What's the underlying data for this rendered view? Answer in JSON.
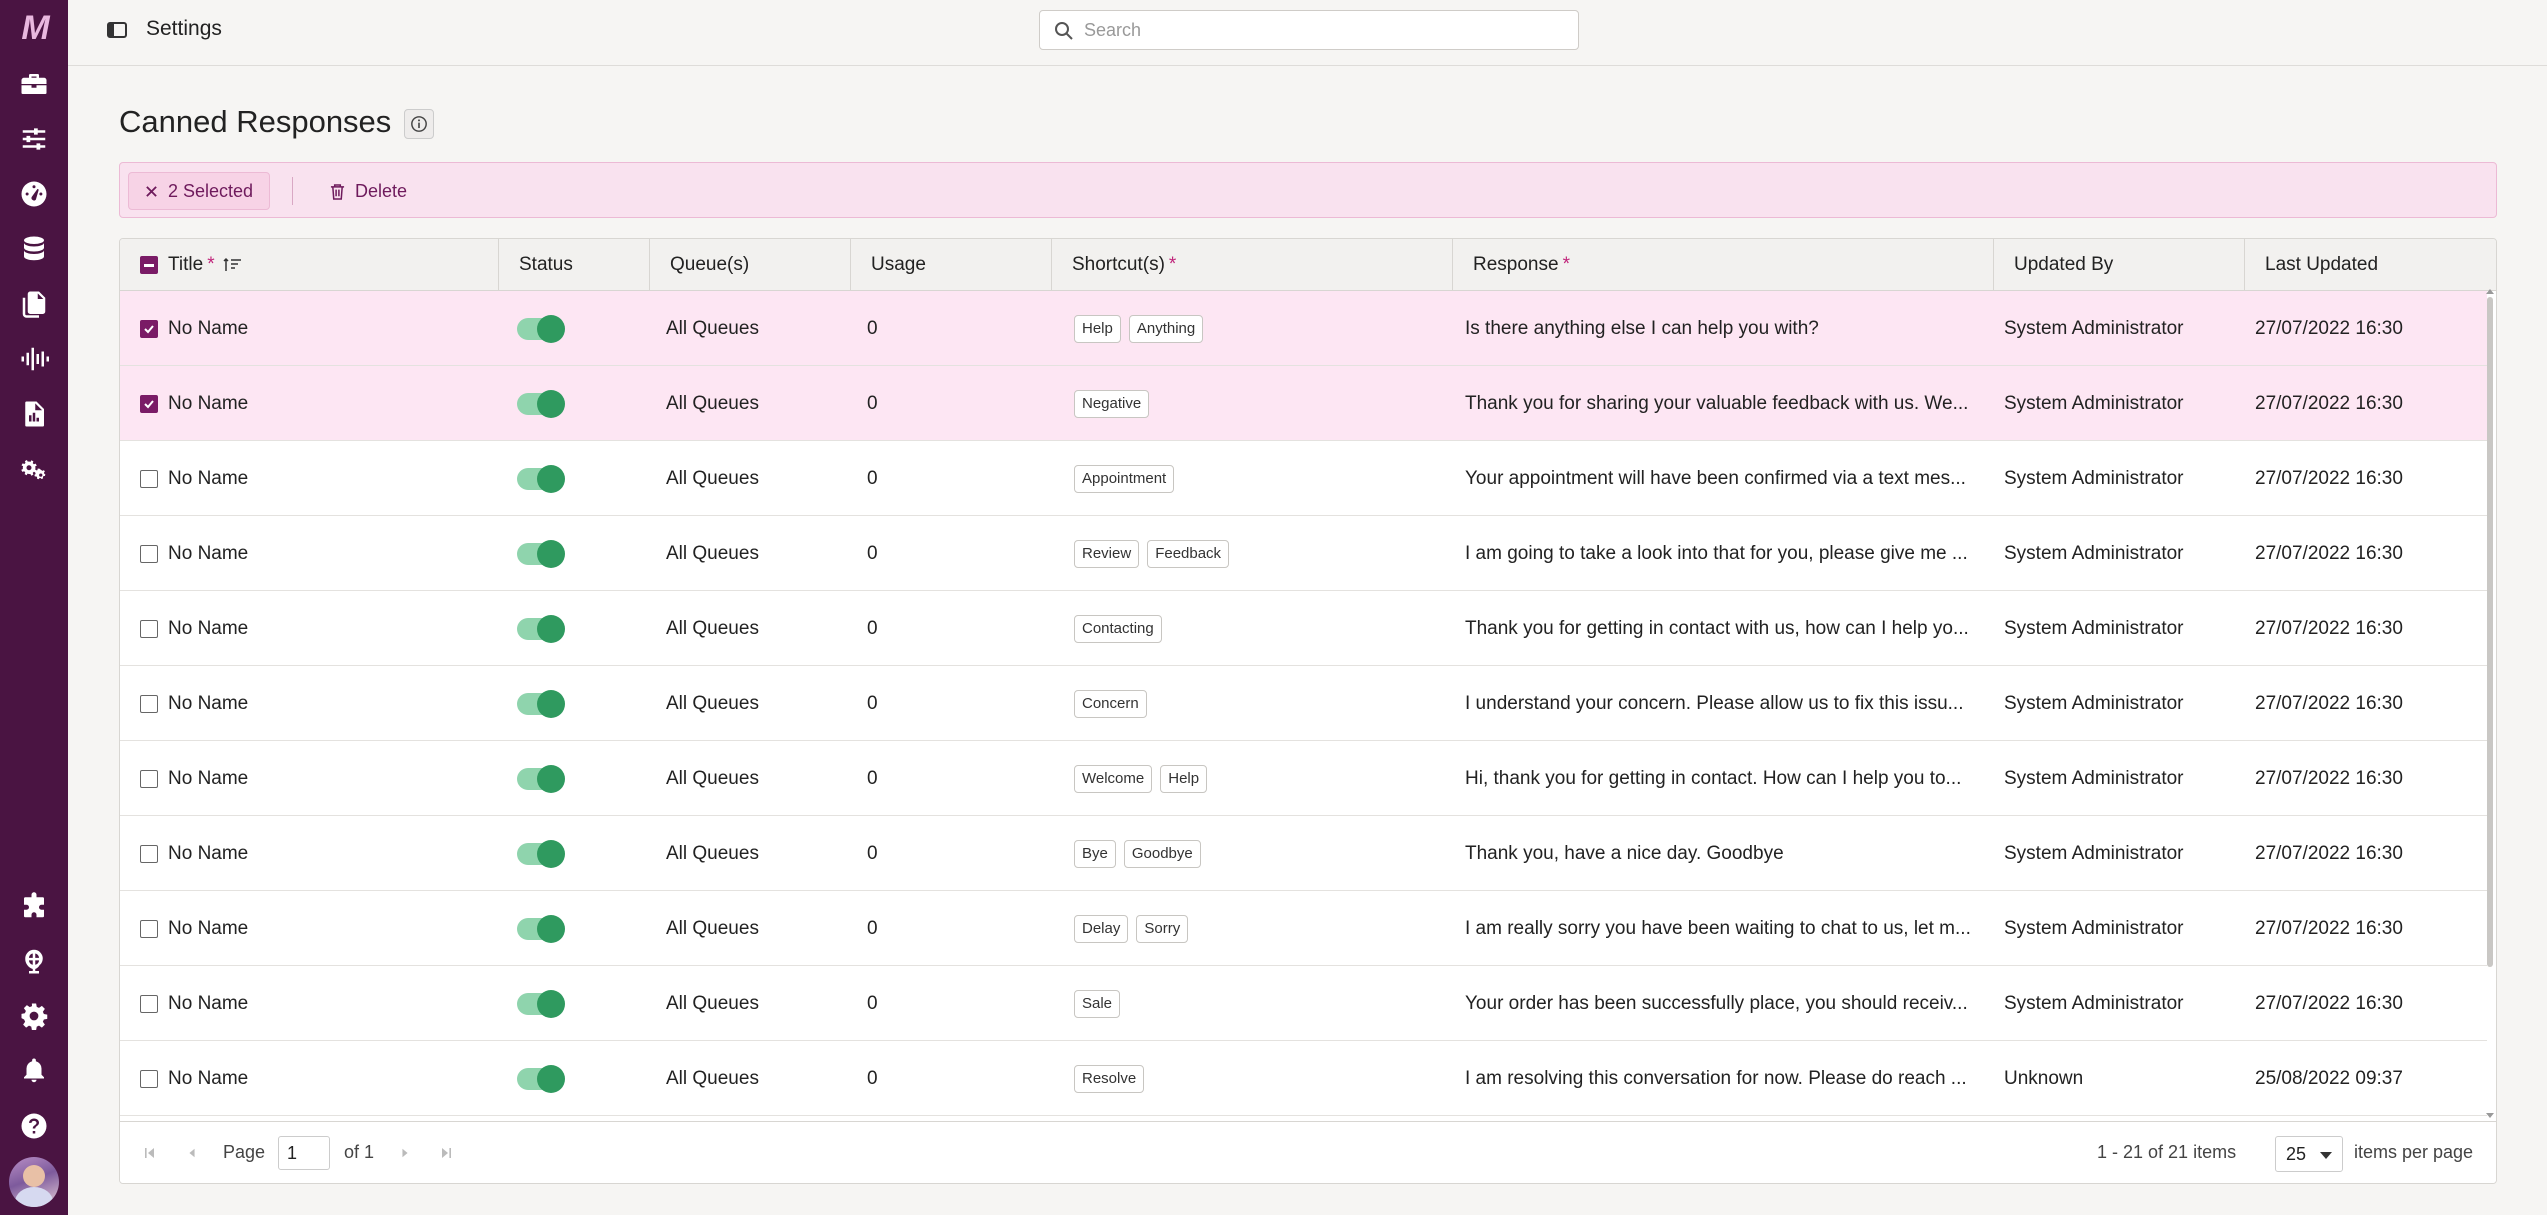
{
  "app": {
    "logo_text": "M"
  },
  "sidebar": {
    "top_icons": [
      "toolbox-icon",
      "sliders-icon",
      "dashboard-gauge-icon",
      "database-icon",
      "documents-icon",
      "audio-waveform-icon",
      "report-file-icon",
      "cogs-icon"
    ],
    "bottom_icons": [
      "puzzle-icon",
      "globe-icon",
      "gear-icon",
      "bell-icon",
      "help-icon"
    ]
  },
  "topbar": {
    "title": "Settings",
    "search_placeholder": "Search"
  },
  "page": {
    "title": "Canned Responses"
  },
  "selection": {
    "selected_label": "2 Selected",
    "delete_label": "Delete"
  },
  "table": {
    "columns": {
      "title": "Title",
      "status": "Status",
      "queues": "Queue(s)",
      "usage": "Usage",
      "shortcuts": "Shortcut(s)",
      "response": "Response",
      "updated_by": "Updated By",
      "last_updated": "Last Updated"
    },
    "required_mark": "*",
    "rows": [
      {
        "checked": true,
        "title": "No Name",
        "status_on": true,
        "queues": "All Queues",
        "usage": "0",
        "shortcuts": [
          "Help",
          "Anything"
        ],
        "response": "Is there anything else I can help you with?",
        "updated_by": "System Administrator",
        "last_updated": "27/07/2022 16:30"
      },
      {
        "checked": true,
        "title": "No Name",
        "status_on": true,
        "queues": "All Queues",
        "usage": "0",
        "shortcuts": [
          "Negative"
        ],
        "response": "Thank you for sharing your valuable feedback with us. We...",
        "updated_by": "System Administrator",
        "last_updated": "27/07/2022 16:30"
      },
      {
        "checked": false,
        "title": "No Name",
        "status_on": true,
        "queues": "All Queues",
        "usage": "0",
        "shortcuts": [
          "Appointment"
        ],
        "response": "Your appointment will have been confirmed via a text mes...",
        "updated_by": "System Administrator",
        "last_updated": "27/07/2022 16:30"
      },
      {
        "checked": false,
        "title": "No Name",
        "status_on": true,
        "queues": "All Queues",
        "usage": "0",
        "shortcuts": [
          "Review",
          "Feedback"
        ],
        "response": "I am going to take a look into that for you, please give me ...",
        "updated_by": "System Administrator",
        "last_updated": "27/07/2022 16:30"
      },
      {
        "checked": false,
        "title": "No Name",
        "status_on": true,
        "queues": "All Queues",
        "usage": "0",
        "shortcuts": [
          "Contacting"
        ],
        "response": "Thank you for getting in contact with us, how can I help yo...",
        "updated_by": "System Administrator",
        "last_updated": "27/07/2022 16:30"
      },
      {
        "checked": false,
        "title": "No Name",
        "status_on": true,
        "queues": "All Queues",
        "usage": "0",
        "shortcuts": [
          "Concern"
        ],
        "response": "I understand your concern. Please allow us to fix this issu...",
        "updated_by": "System Administrator",
        "last_updated": "27/07/2022 16:30"
      },
      {
        "checked": false,
        "title": "No Name",
        "status_on": true,
        "queues": "All Queues",
        "usage": "0",
        "shortcuts": [
          "Welcome",
          "Help"
        ],
        "response": "Hi, thank you for getting in contact. How can I help you to...",
        "updated_by": "System Administrator",
        "last_updated": "27/07/2022 16:30"
      },
      {
        "checked": false,
        "title": "No Name",
        "status_on": true,
        "queues": "All Queues",
        "usage": "0",
        "shortcuts": [
          "Bye",
          "Goodbye"
        ],
        "response": "Thank you, have a nice day. Goodbye",
        "updated_by": "System Administrator",
        "last_updated": "27/07/2022 16:30"
      },
      {
        "checked": false,
        "title": "No Name",
        "status_on": true,
        "queues": "All Queues",
        "usage": "0",
        "shortcuts": [
          "Delay",
          "Sorry"
        ],
        "response": "I am really sorry you have been waiting to chat to us, let m...",
        "updated_by": "System Administrator",
        "last_updated": "27/07/2022 16:30"
      },
      {
        "checked": false,
        "title": "No Name",
        "status_on": true,
        "queues": "All Queues",
        "usage": "0",
        "shortcuts": [
          "Sale"
        ],
        "response": "Your order has been successfully place, you should receiv...",
        "updated_by": "System Administrator",
        "last_updated": "27/07/2022 16:30"
      },
      {
        "checked": false,
        "title": "No Name",
        "status_on": true,
        "queues": "All Queues",
        "usage": "0",
        "shortcuts": [
          "Resolve"
        ],
        "response": "I am resolving this conversation for now. Please do reach ...",
        "updated_by": "Unknown",
        "last_updated": "25/08/2022 09:37"
      }
    ]
  },
  "pager": {
    "page_label": "Page",
    "current_page": "1",
    "of_label": "of 1",
    "range_label": "1 - 21 of 21 items",
    "per_page_value": "25",
    "per_page_label": "items per page"
  },
  "colors": {
    "sidebar": "#4a1442",
    "accent": "#7a1b66",
    "selected_row": "#fde6f3",
    "toggle_on": "#2f9a5f"
  }
}
